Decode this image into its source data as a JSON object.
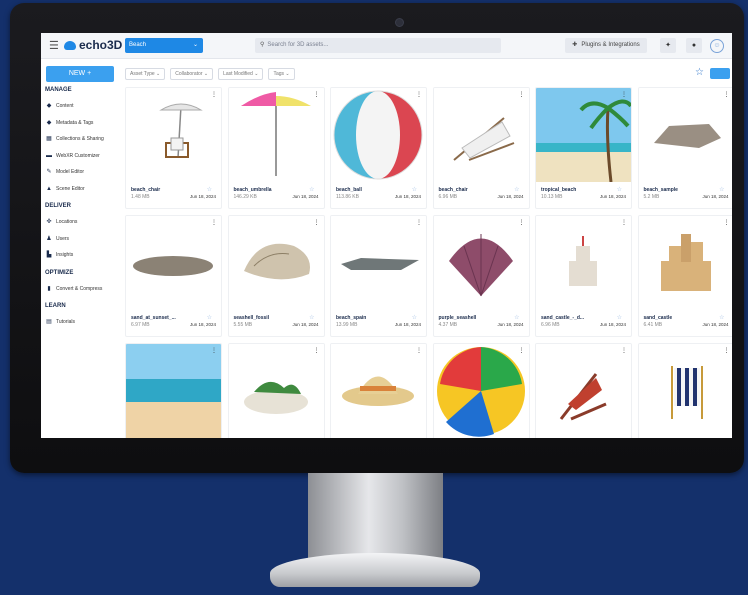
{
  "app": {
    "logo_text": "echo3D",
    "workspace": "Beach",
    "search_placeholder": "Search for 3D assets...",
    "plugins_label": "Plugins & Integrations",
    "new_button": "NEW +"
  },
  "sidebar": {
    "sections": [
      {
        "title": "MANAGE",
        "items": [
          {
            "label": "Content",
            "icon": "cube-icon"
          },
          {
            "label": "Metadata & Tags",
            "icon": "tag-icon"
          },
          {
            "label": "Collections & Sharing",
            "icon": "grid-icon"
          },
          {
            "label": "WebXR Customizer",
            "icon": "vr-headset-icon"
          },
          {
            "label": "Model Editor",
            "icon": "pencil-icon"
          },
          {
            "label": "Scene Editor",
            "icon": "shapes-icon"
          }
        ]
      },
      {
        "title": "DELIVER",
        "items": [
          {
            "label": "Locations",
            "icon": "location-icon"
          },
          {
            "label": "Users",
            "icon": "user-icon"
          },
          {
            "label": "Insights",
            "icon": "chart-icon"
          }
        ]
      },
      {
        "title": "OPTIMIZE",
        "items": [
          {
            "label": "Convert & Compress",
            "icon": "file-icon"
          }
        ]
      },
      {
        "title": "LEARN",
        "items": [
          {
            "label": "Tutorials",
            "icon": "book-icon"
          }
        ]
      }
    ]
  },
  "filters": [
    "Asset Type",
    "Collaborator",
    "Last Modified",
    "Tags"
  ],
  "assets": [
    {
      "name": "beach_chair",
      "size": "1.48 MB",
      "date": "Jun 18, 2024",
      "thumb": "beach-chair-umbrella"
    },
    {
      "name": "beach_umbrella",
      "size": "146.29 KB",
      "date": "Jun 18, 2024",
      "thumb": "umbrella"
    },
    {
      "name": "beach_ball",
      "size": "113.86 KB",
      "date": "Jun 18, 2024",
      "thumb": "ball-red"
    },
    {
      "name": "beach_chair",
      "size": "6.96 MB",
      "date": "Jun 18, 2024",
      "thumb": "lounger"
    },
    {
      "name": "tropical_beach",
      "size": "10.13 MB",
      "date": "Jun 18, 2024",
      "thumb": "tropical"
    },
    {
      "name": "beach_sample",
      "size": "5.2 MB",
      "date": "Jun 18, 2024",
      "thumb": "rock"
    },
    {
      "name": "sand_at_sunset_...",
      "size": "6.97 MB",
      "date": "Jun 18, 2024",
      "thumb": "sand-patch"
    },
    {
      "name": "seashell_fossil",
      "size": "5.55 MB",
      "date": "Jun 18, 2024",
      "thumb": "conch"
    },
    {
      "name": "beach_spain",
      "size": "13.99 MB",
      "date": "Jun 18, 2024",
      "thumb": "flat-rock"
    },
    {
      "name": "purple_seashell",
      "size": "4.37 MB",
      "date": "Jun 18, 2024",
      "thumb": "scallop"
    },
    {
      "name": "sand_castle_-_d...",
      "size": "6.96 MB",
      "date": "Jun 18, 2024",
      "thumb": "castle-small"
    },
    {
      "name": "sand_castle",
      "size": "6.41 MB",
      "date": "Jun 18, 2024",
      "thumb": "castle"
    },
    {
      "name": "",
      "size": "",
      "date": "",
      "thumb": "ocean"
    },
    {
      "name": "",
      "size": "",
      "date": "",
      "thumb": "island"
    },
    {
      "name": "",
      "size": "",
      "date": "",
      "thumb": "hat"
    },
    {
      "name": "",
      "size": "",
      "date": "",
      "thumb": "ball-color"
    },
    {
      "name": "",
      "size": "",
      "date": "",
      "thumb": "deck-chair"
    },
    {
      "name": "",
      "size": "",
      "date": "",
      "thumb": "striped-chair"
    }
  ],
  "colors": {
    "accent": "#1e88e5",
    "new_button": "#3ba0ef",
    "backdrop": "#14306b"
  }
}
